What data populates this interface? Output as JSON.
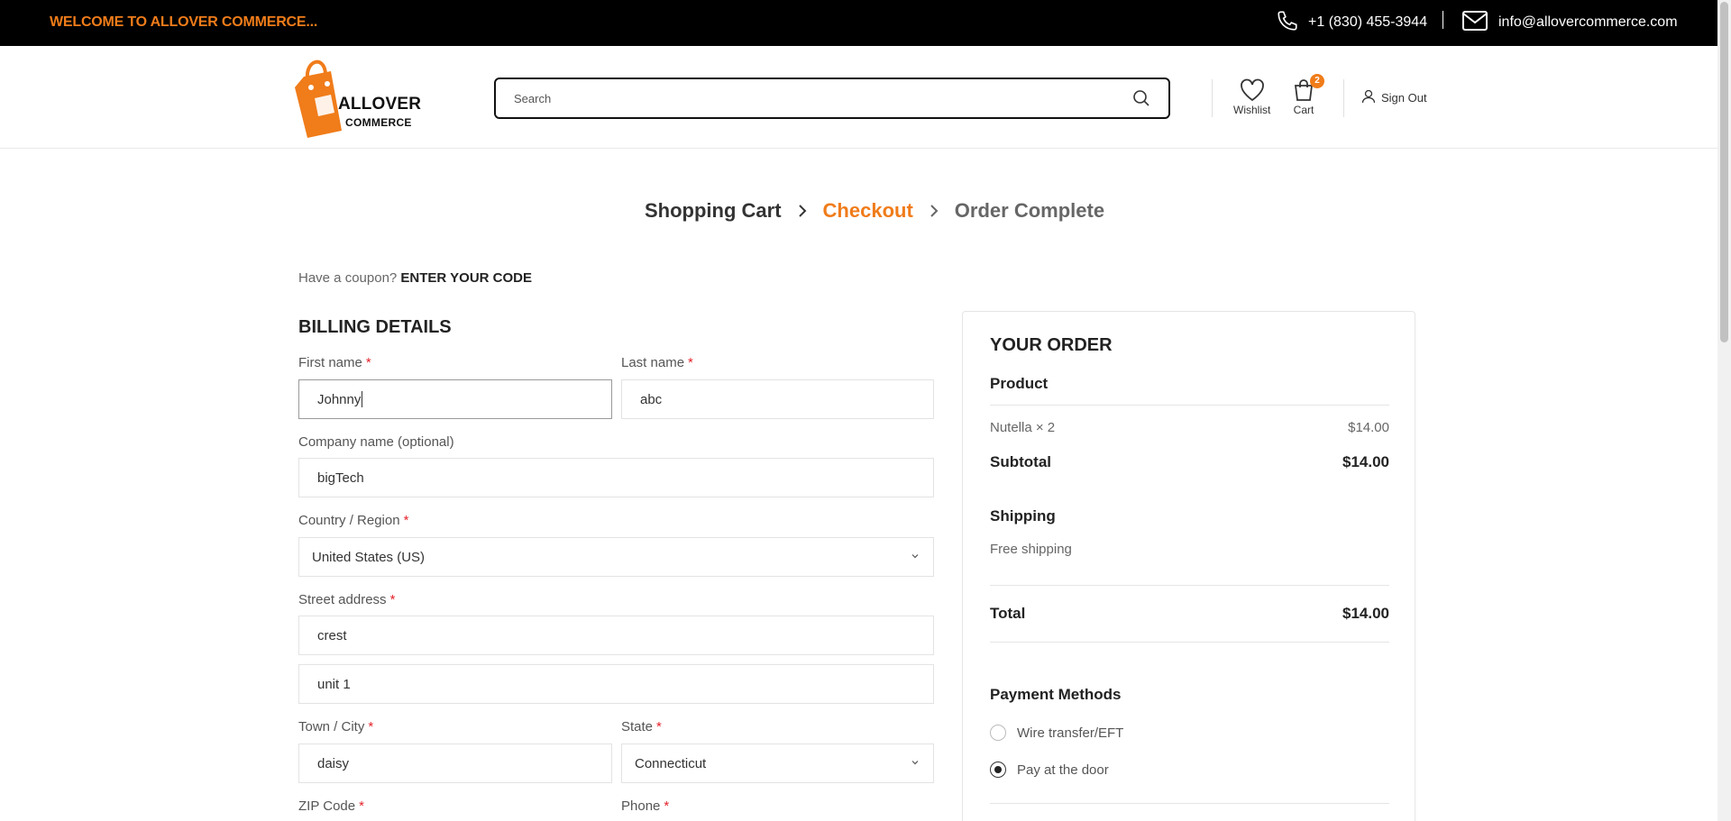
{
  "topbar": {
    "welcome": "WELCOME TO ALLOVER COMMERCE...",
    "phone": "+1 (830) 455-3944",
    "email": "info@allovercommerce.com"
  },
  "header": {
    "logo_line1": "ALLOVER",
    "logo_line2": "COMMERCE",
    "search_placeholder": "Search",
    "wishlist_label": "Wishlist",
    "cart_label": "Cart",
    "cart_count": "2",
    "signout_label": "Sign Out"
  },
  "steps": {
    "cart": "Shopping Cart",
    "checkout": "Checkout",
    "complete": "Order Complete"
  },
  "coupon": {
    "prompt": "Have a coupon?",
    "link": "ENTER YOUR CODE"
  },
  "billing": {
    "title": "BILLING DETAILS",
    "first_name_label": "First name",
    "first_name_value": "Johnny",
    "last_name_label": "Last name",
    "last_name_value": "abc",
    "company_label": "Company name (optional)",
    "company_value": "bigTech",
    "country_label": "Country / Region",
    "country_value": "United States (US)",
    "street_label": "Street address",
    "street_value": "crest",
    "street2_value": "unit 1",
    "city_label": "Town / City",
    "city_value": "daisy",
    "state_label": "State",
    "state_value": "Connecticut",
    "zip_label": "ZIP Code",
    "phone_label": "Phone",
    "required_mark": "*"
  },
  "order": {
    "title": "YOUR ORDER",
    "product_header": "Product",
    "item_name": "Nutella  × 2",
    "item_price": "$14.00",
    "subtotal_label": "Subtotal",
    "subtotal_value": "$14.00",
    "shipping_label": "Shipping",
    "shipping_value": "Free shipping",
    "total_label": "Total",
    "total_value": "$14.00",
    "payment_title": "Payment Methods",
    "payment_option1": "Wire transfer/EFT",
    "payment_option2": "Pay at the door"
  },
  "colors": {
    "accent": "#f07c1a",
    "required": "#e4222a",
    "topbar_bg": "#000000"
  }
}
